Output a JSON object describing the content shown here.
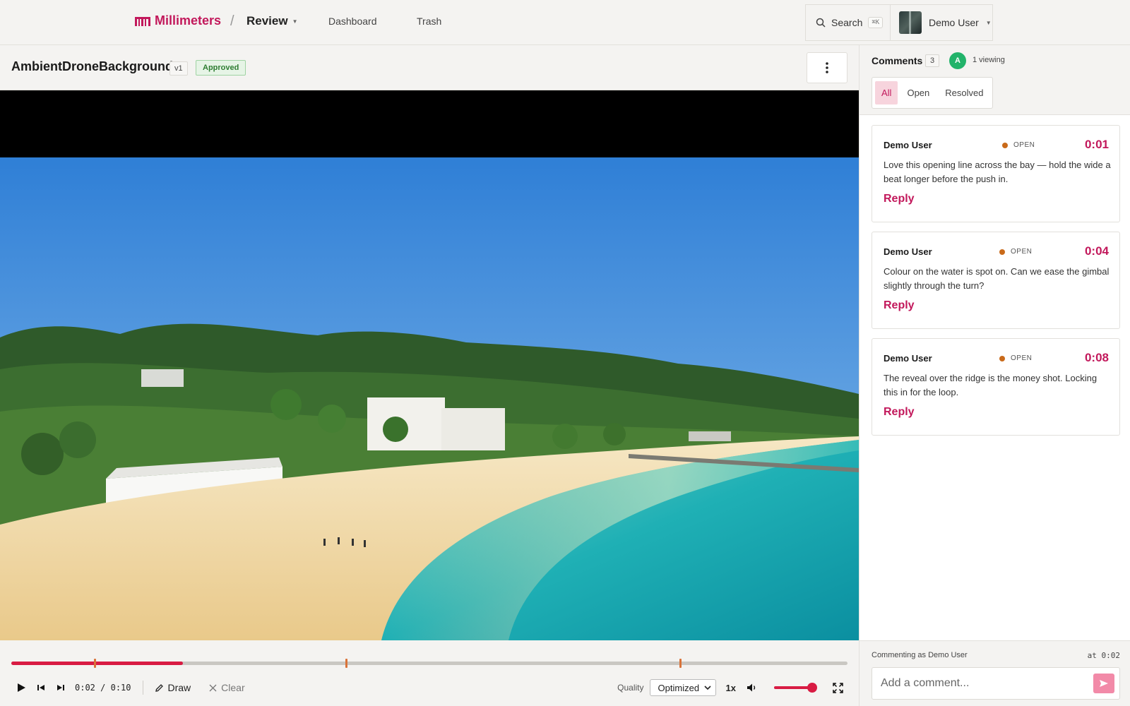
{
  "header": {
    "brand": "Millimeters",
    "breadcrumb_sep": "/",
    "section": "Review",
    "nav": [
      "Dashboard",
      "Trash"
    ],
    "search_label": "Search",
    "search_shortcut": "⌘K",
    "user_name": "Demo User"
  },
  "asset": {
    "title": "AmbientDroneBackground",
    "version": "v1",
    "status": "Approved"
  },
  "player": {
    "current_time": "0:02",
    "duration": "0:10",
    "time_sep": " / ",
    "progress": 0.205,
    "marker_times": [
      0.1,
      0.4,
      0.8
    ],
    "draw_label": "Draw",
    "clear_label": "Clear",
    "quality_label": "Quality",
    "quality_value": "Optimized",
    "speed": "1x",
    "volume": 0.9
  },
  "comments_panel": {
    "title": "Comments",
    "count": "3",
    "viewer_initial": "A",
    "viewing": "1 viewing",
    "filters": [
      "All",
      "Open",
      "Resolved"
    ],
    "active_filter": "All",
    "comments": [
      {
        "author": "Demo User",
        "status": "OPEN",
        "time": "0:01",
        "body": "Love this opening line across the bay — hold the wide a beat longer before the push in.",
        "reply": "Reply"
      },
      {
        "author": "Demo User",
        "status": "OPEN",
        "time": "0:04",
        "body": "Colour on the water is spot on. Can we ease the gimbal slightly through the turn?",
        "reply": "Reply"
      },
      {
        "author": "Demo User",
        "status": "OPEN",
        "time": "0:08",
        "body": "The reveal over the ridge is the money shot. Locking this in for the loop.",
        "reply": "Reply"
      }
    ],
    "commenting_as": "Commenting as Demo User",
    "at_time": "at 0:02",
    "input_placeholder": "Add a comment..."
  },
  "colors": {
    "accent": "#c2185b",
    "scrub_fill": "#d81b43",
    "marker": "#d9733a",
    "approved": "#2e7d32",
    "open_dot": "#c96a1a",
    "viewer": "#22b36a"
  }
}
